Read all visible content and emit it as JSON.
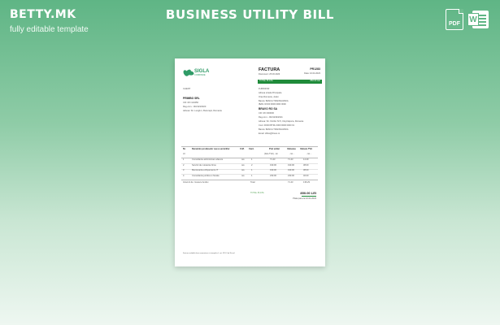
{
  "header": {
    "brand": "BETTY.MK",
    "tagline": "fully editable template",
    "title": "BUSINESS UTILITY BILL"
  },
  "icons": [
    {
      "name": "pdf-file-icon",
      "label": "PDF"
    },
    {
      "name": "word-file-icon",
      "label": "W"
    }
  ],
  "document": {
    "logo": {
      "name": "SIGLA",
      "sub": "COMPANIE"
    },
    "title": "FACTURA",
    "number": "PR1283",
    "date_line": "Document: 25.03.2023",
    "due_line": "Data: 10.04.2023",
    "bar_left": "TOTAL PLATA",
    "bar_right": "850.00 LEI",
    "client_heading": "CLIENT",
    "client": [
      "PRIMBO SRL",
      "CIF: RO 123456",
      "Reg.com.: J40/123/2020",
      "Adresa: Str. Lungă 1, Bucureşti, Romania"
    ],
    "supplier_heading": "FURNIZOR",
    "supplier_lines": [
      "Adresa strada Principala",
      "Oras Romania, Judet",
      "Banca: BANCA TRANSILVANIA",
      "IBAN: RO00 0000 0000 0000"
    ],
    "supplier_name": "BRAVO RO SA",
    "supplier_details": [
      "CIF: RO 000000",
      "Reg.com.: J40/1234/2021",
      "Adresa: Str. Florilor Nr.5, Cluj-Napoca, Romania",
      "Cont: RO00 BTRL 0000 0000 0000 01",
      "Banca: BANCA TRANSILVANIA",
      "Email: office@bravo.ro"
    ],
    "columns": [
      "Nr.",
      "Denumire produselor sau a serviciilor",
      "U.M.",
      "Cant.",
      "Pret unitar",
      "Valoarea",
      "Valoare TVA"
    ],
    "subheads": [
      "crt",
      "(fara TVA) - lei",
      "- lei -",
      "- lei -"
    ],
    "rows": [
      {
        "nr": "1",
        "desc": "Consultanta administrare afacere",
        "um": "ore",
        "qty": "1",
        "price": "71.43",
        "value": "71.43",
        "vat": "14.29"
      },
      {
        "nr": "2",
        "desc": "Servicii de curatenie birou",
        "um": "ore",
        "qty": "2",
        "price": "190.00",
        "value": "190.00",
        "vat": "38.00"
      },
      {
        "nr": "3",
        "desc": "Mentenanta echipamente IT",
        "um": "ore",
        "qty": "1",
        "price": "190.00",
        "value": "190.00",
        "vat": "38.00"
      },
      {
        "nr": "4",
        "desc": "Consultanta juridica si fiscala",
        "um": "ore",
        "qty": "1",
        "price": "230.00",
        "value": "230.00",
        "vat": "46.00"
      }
    ],
    "delegate": "Intocmit de: Ionescu Andrei",
    "total_label": "Total",
    "total_value": "71.43",
    "total_vat": "136.29",
    "pay_label": "TOTAL PLATA",
    "grand_total": "850.00 LEI",
    "pay_until": "Plata pana la 10.04.2023",
    "footer": "Factura valabila fara semnatura si stampila cf. art. 319 Cod Fiscal"
  }
}
